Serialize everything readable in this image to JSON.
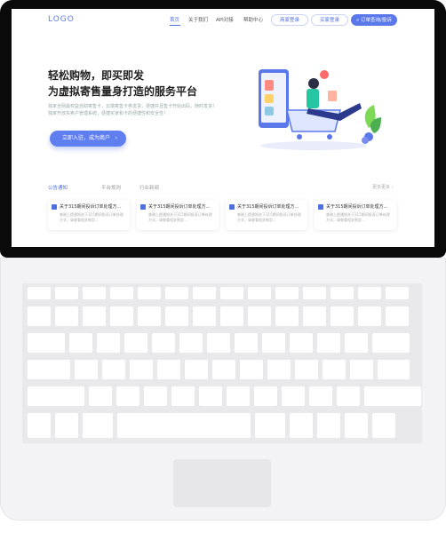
{
  "site": {
    "logo": "LOGO",
    "nav": [
      "首页",
      "关于我们",
      "API对接",
      "帮助中心"
    ],
    "buyer_login": "商家登录",
    "seller_register": "买家登录",
    "order_query": "订单查询/投诉"
  },
  "hero": {
    "title_line1": "轻松购物，即买即发",
    "title_line2": "为虚拟寄售量身打造的服务平台",
    "sub_line1": "独家全网最权益自助寄售卡，云端寄售卡券发货，便捷并且售卡开始出码，随时发货！",
    "sub_line2": "独家开放买卖户管理系统，便捷买家和卡的便捷性和安全性！",
    "cta": "立即入驻，成为商户",
    "cta_arrow": "›"
  },
  "notices": {
    "tabs": [
      "公告通知",
      "平台规则",
      "行业新闻"
    ],
    "more": "更多更多 ›",
    "cards": [
      {
        "title": "关于315期间投诉订单处理方...",
        "body": "感谢上提通知关于315期间投诉订单处理方式，请查看相关制定..."
      },
      {
        "title": "关于315期间投诉订单处理方...",
        "body": "感谢上提通知关于315期间投诉订单处理方式，请查看相关制定..."
      },
      {
        "title": "关于315期间投诉订单处理方...",
        "body": "感谢上提通知关于315期间投诉订单处理方式，请查看相关制定..."
      },
      {
        "title": "关于315期间投诉订单处理方...",
        "body": "感谢上提通知关于315期间投诉订单处理方式，请查看相关制定..."
      }
    ]
  },
  "colors": {
    "accent": "#5a78ea",
    "frame": "#0a0a0a",
    "base": "#f3f3f5"
  },
  "icons": [
    "search-icon",
    "shopping-cart-illustration",
    "check-icon",
    "arrow-right-icon"
  ]
}
